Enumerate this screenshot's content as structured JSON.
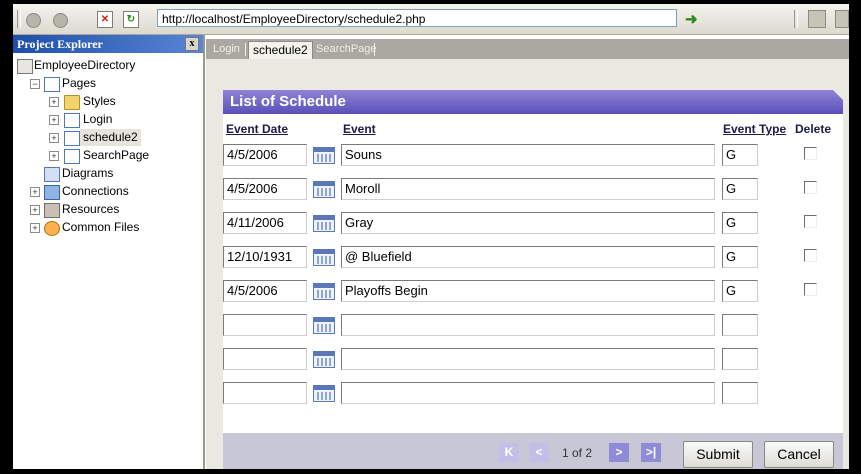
{
  "browser": {
    "url": "http://localhost/EmployeeDirectory/schedule2.php"
  },
  "explorer": {
    "title": "Project Explorer",
    "close_glyph": "x",
    "project": "EmployeeDirectory",
    "pages_folder": "Pages",
    "pages": [
      "Styles",
      "Login",
      "schedule2",
      "SearchPage"
    ],
    "other": [
      "Diagrams",
      "Connections",
      "Resources",
      "Common Files"
    ],
    "expander_plus": "+",
    "expander_minus": "−"
  },
  "tabs": [
    "Login",
    "schedule2",
    "SearchPage"
  ],
  "panel": {
    "title": "List of Schedule",
    "headers": {
      "date": "Event Date",
      "event": "Event",
      "type": "Event Type",
      "delete": "Delete"
    },
    "rows": [
      {
        "date": "4/5/2006",
        "event": "Souns",
        "type": "G",
        "has_delete": true
      },
      {
        "date": "4/5/2006",
        "event": "Moroll",
        "type": "G",
        "has_delete": true
      },
      {
        "date": "4/11/2006",
        "event": "Gray",
        "type": "G",
        "has_delete": true
      },
      {
        "date": "12/10/1931",
        "event": "@ Bluefield",
        "type": "G",
        "has_delete": true
      },
      {
        "date": "4/5/2006",
        "event": "Playoffs Begin",
        "type": "G",
        "has_delete": true
      },
      {
        "date": "",
        "event": "",
        "type": "",
        "has_delete": false
      },
      {
        "date": "",
        "event": "",
        "type": "",
        "has_delete": false
      },
      {
        "date": "",
        "event": "",
        "type": "",
        "has_delete": false
      }
    ]
  },
  "pager": {
    "first": "K",
    "prev": "<",
    "label": "1 of 2",
    "next": ">",
    "last": ">|",
    "submit": "Submit",
    "cancel": "Cancel"
  },
  "colors": {
    "panel_header": "#6a5fc4",
    "pager_bar": "#c8c7d6",
    "explorer_header": "#1e4fa8"
  }
}
